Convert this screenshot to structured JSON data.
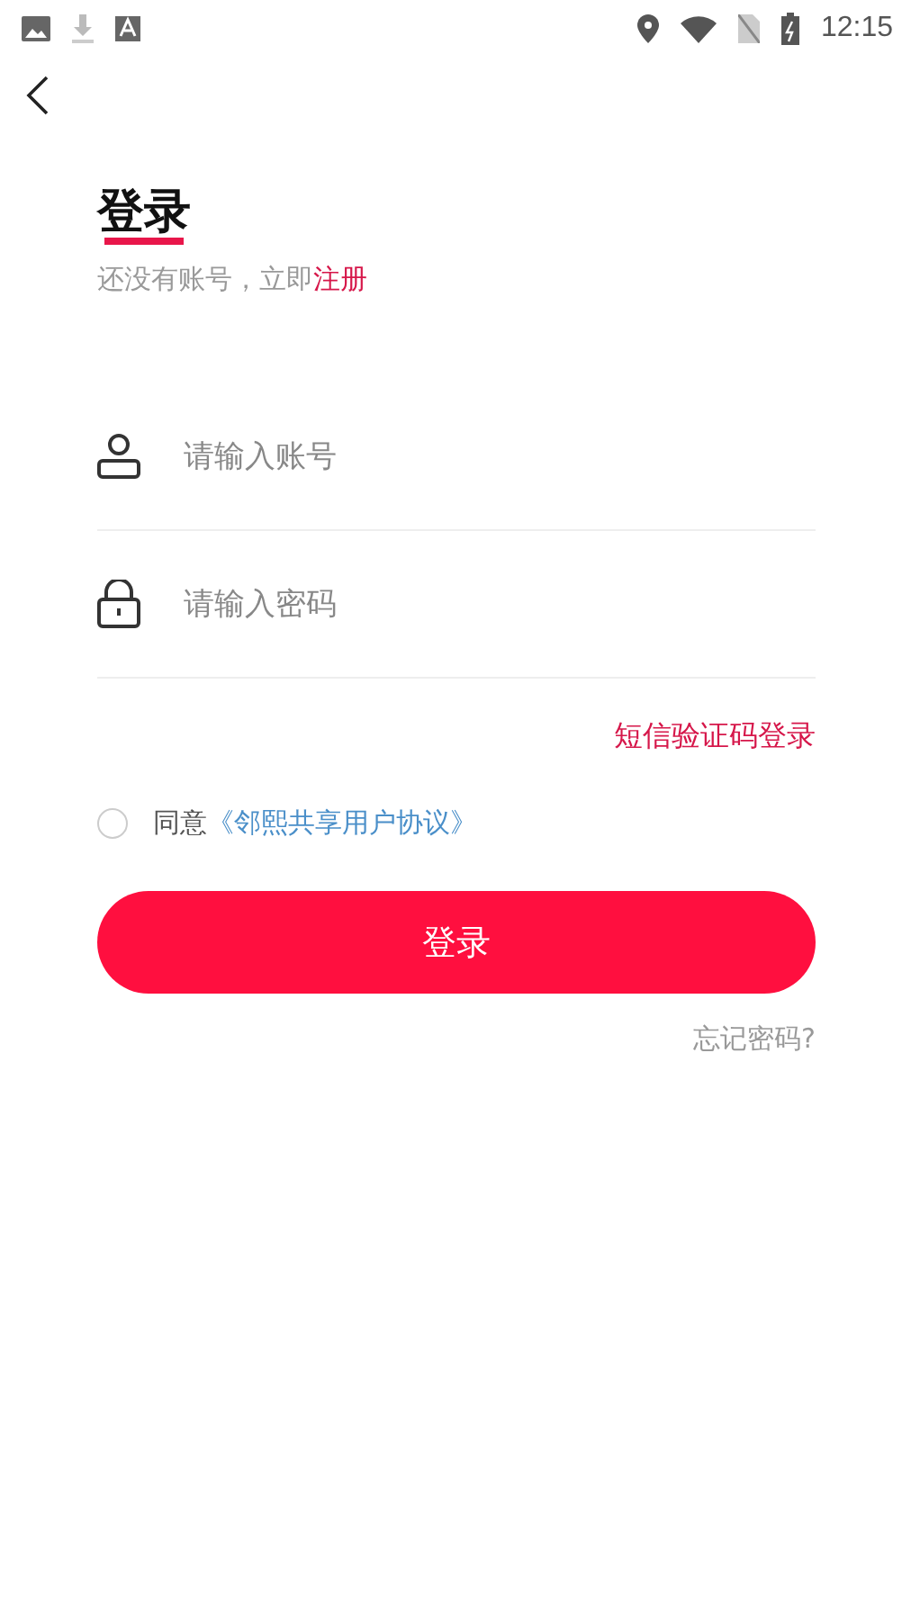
{
  "status_bar": {
    "time": "12:15"
  },
  "title": "登录",
  "subtitle": {
    "text": "还没有账号，立即",
    "link": "注册"
  },
  "fields": [
    {
      "kind": "account",
      "placeholder": "请输入账号"
    },
    {
      "kind": "password",
      "placeholder": "请输入密码"
    }
  ],
  "sms_login_link": "短信验证码登录",
  "agreement": {
    "checked": false,
    "text": "同意",
    "link": "《邻熙共享用户协议》"
  },
  "login_button": "登录",
  "forgot_password_link": "忘记密码?"
}
